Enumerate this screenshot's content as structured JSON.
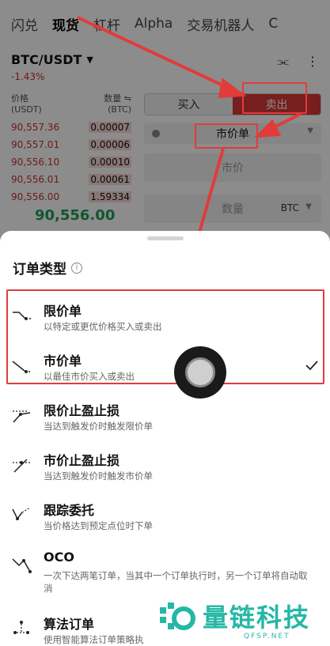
{
  "tabs": [
    {
      "label": "闪兑"
    },
    {
      "label": "现货"
    },
    {
      "label": "杠杆"
    },
    {
      "label": "Alpha"
    },
    {
      "label": "交易机器人"
    },
    {
      "label": "C"
    }
  ],
  "market": {
    "pair": "BTC/USDT",
    "change": "-1.43%",
    "last_price": "90,556.00"
  },
  "orderbook": {
    "price_header": "价格\n(USDT)",
    "qty_header": "数量 ⇋\n(BTC)",
    "rows": [
      {
        "price": "90,557.36",
        "qty": "0.00007"
      },
      {
        "price": "90,557.01",
        "qty": "0.00006"
      },
      {
        "price": "90,556.10",
        "qty": "0.00010"
      },
      {
        "price": "90,556.01",
        "qty": "0.00061"
      },
      {
        "price": "90,556.00",
        "qty": "1.59334"
      }
    ]
  },
  "trade_panel": {
    "buy_label": "买入",
    "sell_label": "卖出",
    "order_type": "市价单",
    "price_placeholder": "市价",
    "qty_placeholder": "数量",
    "qty_unit": "BTC"
  },
  "sheet": {
    "title": "订单类型",
    "options": [
      {
        "name": "限价单",
        "desc": "以特定或更优价格买入或卖出",
        "icon": "limit-order-icon"
      },
      {
        "name": "市价单",
        "desc": "以最佳市价买入或卖出",
        "icon": "market-order-icon",
        "selected": true
      },
      {
        "name": "限价止盈止损",
        "desc": "当达到触发价时触发限价单",
        "icon": "stop-limit-icon"
      },
      {
        "name": "市价止盈止损",
        "desc": "当达到触发价时触发市价单",
        "icon": "stop-market-icon"
      },
      {
        "name": "跟踪委托",
        "desc": "当价格达到预定点位时下单",
        "icon": "trailing-stop-icon"
      },
      {
        "name": "OCO",
        "desc": "一次下达两笔订单，当其中一个订单执行时，另一个订单将自动取消",
        "icon": "oco-icon"
      },
      {
        "name": "算法订单",
        "desc": "使用智能算法订单策略执",
        "icon": "algo-order-icon"
      }
    ]
  },
  "watermark": {
    "brand": "量链科技",
    "sub": "QFSP.NET",
    "color": "#25b7a5"
  },
  "colors": {
    "sell": "#d93a38",
    "buy_price": "#1f9d57",
    "annotation": "#e23b3b"
  }
}
